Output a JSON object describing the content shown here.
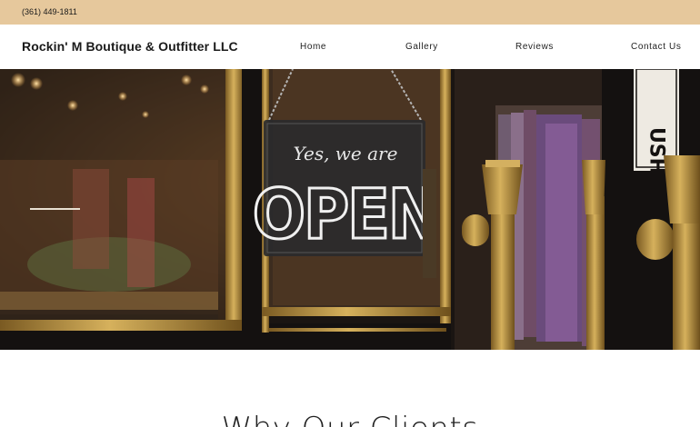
{
  "topbar": {
    "phone": "(361) 449-1811"
  },
  "header": {
    "brand": "Rockin' M Boutique & Outfitter LLC",
    "nav": [
      "Home",
      "Gallery",
      "Reviews",
      "Contact Us"
    ]
  },
  "hero": {
    "sign_script": "Yes, we are",
    "sign_main": "OPEN",
    "door_lettering": "USH"
  },
  "main": {
    "section_title": "Why Our Clients"
  },
  "colors": {
    "topbar": "#e6c89c",
    "brass": "#b8923f",
    "door": "#141110"
  }
}
